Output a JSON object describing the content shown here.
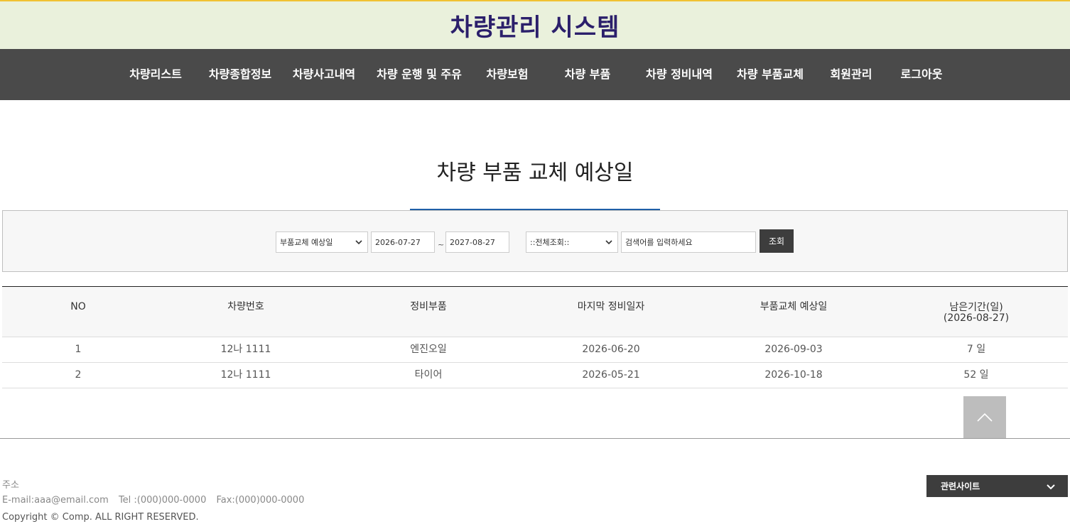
{
  "header": {
    "title": "차량관리 시스템"
  },
  "nav": {
    "items": [
      "차량리스트",
      "차량종합정보",
      "차량사고내역",
      "차량 운행 및 주유",
      "차량보험",
      "차량 부품",
      "차량 정비내역",
      "차량 부품교체",
      "회원관리",
      "로그아웃"
    ]
  },
  "page": {
    "title": "차량 부품 교체 예상일"
  },
  "search": {
    "date_type": "부품교체 예상일",
    "start_date": "2026-07-27",
    "separator": "~",
    "end_date": "2027-08-27",
    "filter": "::전체조회::",
    "keyword_placeholder": "검색어를 입력하세요",
    "button_label": "조회"
  },
  "table": {
    "headers": [
      "NO",
      "차량번호",
      "정비부품",
      "마지막 정비일자",
      "부품교체 예상일",
      "남은기간(일)"
    ],
    "remaining_sub": "(2026-08-27)",
    "rows": [
      [
        "1",
        "12나 1111",
        "엔진오일",
        "2026-06-20",
        "2026-09-03",
        "7 일"
      ],
      [
        "2",
        "12나 1111",
        "타이어",
        "2026-05-21",
        "2026-10-18",
        "52 일"
      ]
    ]
  },
  "footer": {
    "address_label": "주소",
    "email": "E-mail:aaa@email.com",
    "tel": "Tel :(000)000-0000",
    "fax": "Fax:(000)000-0000",
    "copyright": "Copyright © Comp. ALL RIGHT RESERVED.",
    "related_sites": "관련사이트"
  },
  "colors": {
    "banner_bg": "#eaf1dc",
    "banner_top_border": "#f1c232",
    "title_color": "#2b1f6b",
    "nav_bg": "#4a4a4a",
    "accent_underline": "#1f5fa8",
    "button_dark": "#3d3d3d",
    "top_button": "#bdbdbd"
  },
  "icons": {
    "select_arrow": "chevron-down-icon",
    "top_button": "chevron-up-icon",
    "related_arrow": "chevron-down-icon"
  }
}
